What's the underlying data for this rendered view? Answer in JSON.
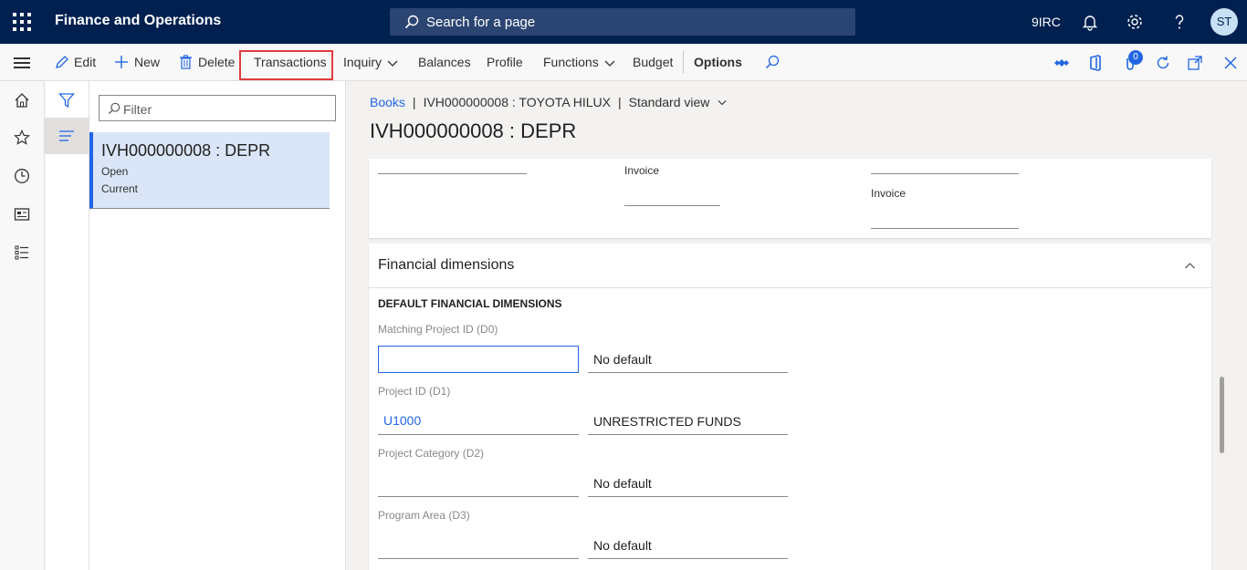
{
  "header": {
    "app_title": "Finance and Operations",
    "search_placeholder": "Search for a page",
    "company": "9IRC",
    "avatar_initials": "ST",
    "icons": [
      "waffle-icon",
      "search-icon",
      "bell-icon",
      "gear-icon",
      "help-icon"
    ]
  },
  "action_pane": {
    "edit": "Edit",
    "new": "New",
    "delete": "Delete",
    "transactions": "Transactions",
    "inquiry": "Inquiry",
    "balances": "Balances",
    "profile": "Profile",
    "functions": "Functions",
    "budget": "Budget",
    "options": "Options",
    "attachments_count": "0",
    "highlight_color": "#e03c3c"
  },
  "list_pane": {
    "filter_placeholder": "Filter",
    "selected_item": {
      "title": "IVH000000008 : DEPR",
      "line1": "Open",
      "line2": "Current"
    }
  },
  "breadcrumb": {
    "books": "Books",
    "asset": "IVH000000008 : TOYOTA HILUX",
    "view": "Standard view"
  },
  "page_title": "IVH000000008 : DEPR",
  "top_card": {
    "label_a": "Invoice",
    "label_b": "Invoice"
  },
  "financial_dimensions": {
    "section_title": "Financial dimensions",
    "group_title": "DEFAULT FINANCIAL DIMENSIONS",
    "fields": [
      {
        "label": "Matching Project ID (D0)",
        "value": "",
        "description": "No default"
      },
      {
        "label": "Project ID (D1)",
        "value": "U1000",
        "description": "UNRESTRICTED FUNDS"
      },
      {
        "label": "Project Category (D2)",
        "value": "",
        "description": "No default"
      },
      {
        "label": "Program Area (D3)",
        "value": "",
        "description": "No default"
      }
    ]
  },
  "colors": {
    "header_bg": "#002050",
    "accent": "#2266e3",
    "selected_bg": "#dae6f8"
  }
}
